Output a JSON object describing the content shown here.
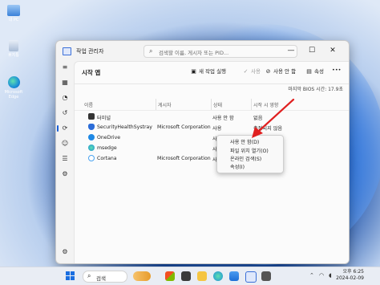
{
  "desktop": {
    "icons": [
      {
        "label": "내 PC",
        "icon": "pc-icon"
      },
      {
        "label": "휴지통",
        "icon": "recycle-bin-icon"
      },
      {
        "label": "Microsoft Edge",
        "icon": "edge-icon"
      }
    ]
  },
  "window": {
    "title": "작업 관리자",
    "search_placeholder": "검색할 이름, 게시자 또는 PID...",
    "controls": {
      "minimize": "—",
      "maximize": "☐",
      "close": "✕"
    }
  },
  "sidebar": {
    "items": [
      {
        "name": "processes",
        "icon": "grid-icon",
        "glyph": "▦"
      },
      {
        "name": "performance",
        "icon": "performance-icon",
        "glyph": "◔"
      },
      {
        "name": "app-history",
        "icon": "history-icon",
        "glyph": "↺"
      },
      {
        "name": "startup-apps",
        "icon": "startup-icon",
        "glyph": "⟳",
        "active": true
      },
      {
        "name": "users",
        "icon": "users-icon",
        "glyph": "☺"
      },
      {
        "name": "details",
        "icon": "details-icon",
        "glyph": "☰"
      },
      {
        "name": "services",
        "icon": "services-icon",
        "glyph": "⚙"
      },
      {
        "name": "settings",
        "icon": "settings-icon",
        "glyph": "⚙"
      }
    ]
  },
  "page": {
    "title": "시작 앱",
    "toolbar": {
      "new_task": "새 작업 실행",
      "enable": "사용",
      "disable": "사용 안 함",
      "properties": "속성",
      "more": "•••"
    },
    "bios_time": "마지막 BIOS 시간: 17.9초",
    "columns": [
      "이름",
      "게시자",
      "상태",
      "시작 시 영향"
    ]
  },
  "rows": [
    {
      "name": "터미널",
      "publisher": "",
      "status": "사용 안 함",
      "impact": "없음",
      "color": "#333333"
    },
    {
      "name": "SecurityHealthSystray",
      "publisher": "Microsoft Corporation",
      "status": "사용",
      "impact": "측정되지 않음",
      "color": "#2b6cd8"
    },
    {
      "name": "OneDrive",
      "publisher": "",
      "status": "사",
      "impact": "",
      "color": "#1e88e5"
    },
    {
      "name": "msedge",
      "publisher": "",
      "status": "사",
      "impact": "",
      "color": "#1aa260"
    },
    {
      "name": "Cortana",
      "publisher": "Microsoft Corporation",
      "status": "사",
      "impact": "",
      "color": "#4aa3f0"
    }
  ],
  "context_menu": {
    "items": [
      "사용 안 함(D)",
      "파일 위치 열기(O)",
      "온라인 검색(S)",
      "속성(I)"
    ]
  },
  "taskbar": {
    "search_label": "검색",
    "time": "오후 6:25",
    "date": "2024-02-09"
  }
}
